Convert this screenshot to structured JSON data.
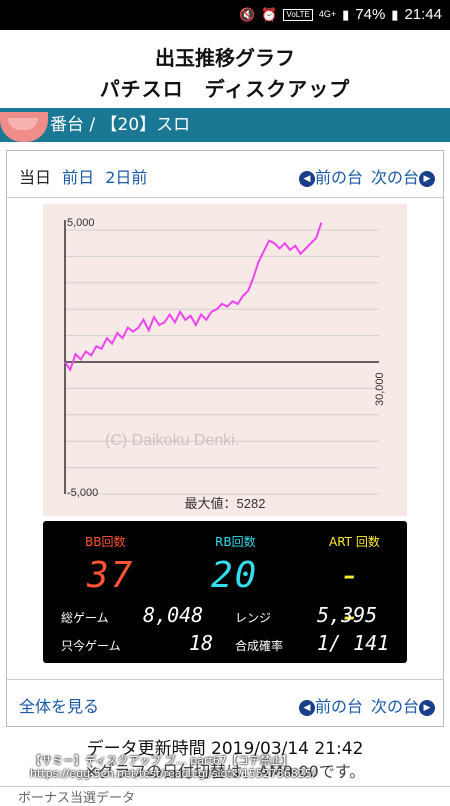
{
  "status": {
    "battery": "74%",
    "time": "21:44",
    "volte": "VoLTE",
    "net": "4G+"
  },
  "header": {
    "title": "出玉推移グラフ",
    "subtitle": "パチスロ　ディスクアップ"
  },
  "machine": {
    "label": "番台 / 【20】スロ"
  },
  "nav": {
    "today": "当日",
    "prev_day": "前日",
    "two_days": "2日前",
    "prev_machine": "前の台",
    "next_machine": "次の台"
  },
  "chart_data": {
    "type": "line",
    "x_range": [
      0,
      30000
    ],
    "ylim": [
      -5000,
      5000
    ],
    "ytick_labels": [
      "5,000",
      "-5,000"
    ],
    "xtick_label": "30,000",
    "watermark": "(C) Daikoku Denki.",
    "max_label": "最大値：5282",
    "series": [
      {
        "color": "#ee44ee",
        "points": [
          [
            0,
            0
          ],
          [
            500,
            -300
          ],
          [
            1000,
            300
          ],
          [
            1500,
            100
          ],
          [
            2000,
            400
          ],
          [
            2500,
            250
          ],
          [
            3000,
            600
          ],
          [
            3500,
            500
          ],
          [
            4000,
            900
          ],
          [
            4500,
            700
          ],
          [
            5000,
            1100
          ],
          [
            5500,
            900
          ],
          [
            6000,
            1300
          ],
          [
            6500,
            1150
          ],
          [
            7000,
            1300
          ],
          [
            7500,
            1600
          ],
          [
            8000,
            1200
          ],
          [
            8500,
            1700
          ],
          [
            9000,
            1400
          ],
          [
            9500,
            1500
          ],
          [
            10000,
            1800
          ],
          [
            10500,
            1500
          ],
          [
            11000,
            1900
          ],
          [
            11500,
            1600
          ],
          [
            12000,
            1750
          ],
          [
            12500,
            1400
          ],
          [
            13000,
            1800
          ],
          [
            13500,
            1600
          ],
          [
            14000,
            1900
          ],
          [
            14500,
            2000
          ],
          [
            15000,
            2200
          ],
          [
            15500,
            2100
          ],
          [
            16000,
            2300
          ],
          [
            16500,
            2200
          ],
          [
            17000,
            2500
          ],
          [
            17500,
            2700
          ],
          [
            18000,
            3200
          ],
          [
            18500,
            3800
          ],
          [
            19000,
            4200
          ],
          [
            19500,
            4600
          ],
          [
            20000,
            4500
          ],
          [
            20500,
            4300
          ],
          [
            21000,
            4500
          ],
          [
            21500,
            4250
          ],
          [
            22000,
            4400
          ],
          [
            22500,
            4100
          ],
          [
            23000,
            4300
          ],
          [
            23500,
            4500
          ],
          [
            24000,
            4700
          ],
          [
            24500,
            5282
          ]
        ]
      }
    ]
  },
  "counters": {
    "bb": {
      "label": "BB回数",
      "value": "37",
      "color": "#ff5533"
    },
    "rb": {
      "label": "RB回数",
      "value": "20",
      "color": "#33ddee"
    },
    "art": {
      "label": "ART 回数",
      "value": "- -",
      "color": "#ffee33"
    }
  },
  "stats": {
    "total_games_label": "総ゲーム",
    "total_games": "8,048",
    "range_label": "レンジ",
    "range": "5,395",
    "current_games_label": "只今ゲーム",
    "current_games": "18",
    "prob_label": "合成確率",
    "prob": "1/ 141"
  },
  "bottom": {
    "view_all": "全体を見る",
    "prev_machine": "前の台",
    "next_machine": "次の台"
  },
  "update": "データ更新時間 2019/03/14 21:42",
  "cutoff_text": "※グラフの日付切替は、AM9:00です。",
  "overlay": {
    "line1": "【サミー】ディスクアップ ブ… part67【コテ禁止】",
    "line2": "https://egg.5ch.net/test/read.cgi/slotk/1552736825/"
  },
  "partial": "ボーナス当選データ"
}
